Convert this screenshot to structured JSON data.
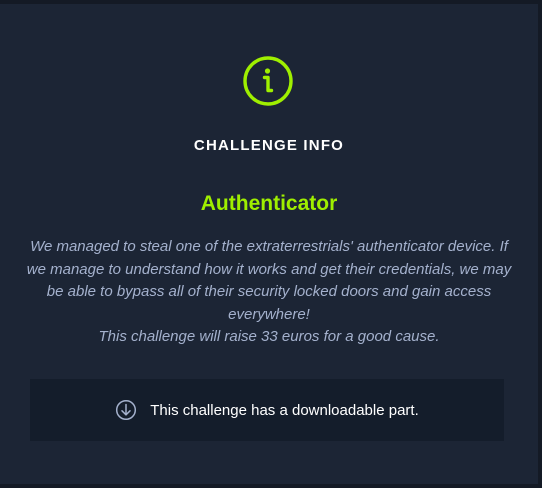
{
  "modal": {
    "icon": "info-circle-icon",
    "heading": "CHALLENGE INFO",
    "challenge_name": "Authenticator",
    "description": "We managed to steal one of the extraterrestrials' authenticator device. If we manage to understand how it works and get their credentials, we may be able to bypass all of their security locked doors and gain access everywhere!",
    "reward_text": "This challenge will raise 33 euros for a good cause.",
    "download": {
      "icon": "download-icon",
      "label": "This challenge has a downloadable part."
    }
  },
  "colors": {
    "background": "#1c2535",
    "accent": "#9fef00",
    "description_text": "#a4b1cd",
    "download_box": "#141d2b"
  }
}
